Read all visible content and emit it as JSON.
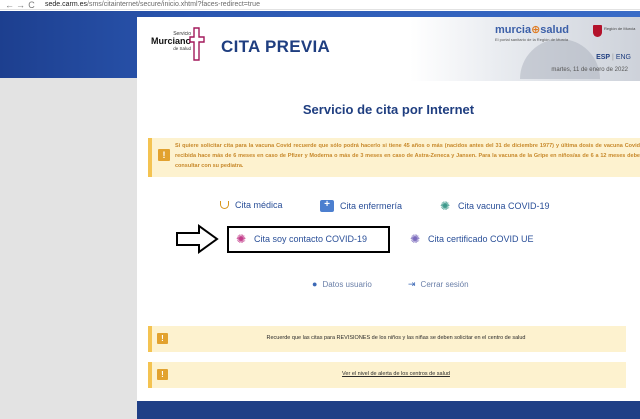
{
  "browser": {
    "nav_back": "←",
    "nav_forward": "→",
    "nav_reload": "C",
    "url_host": "sede.carm.es",
    "url_path": "/sms/citainternet/secure/inicio.xhtml?faces-redirect=true"
  },
  "header": {
    "logo": {
      "line1": "Servicio",
      "line2": "Murciano",
      "line3": "de Salud"
    },
    "title": "CITA PREVIA",
    "brand_part1": "murcia",
    "brand_dot": "⊕",
    "brand_part2": "salud",
    "brand_subtitle": "El portal sanitario de la Región de Murcia",
    "region_text": "Región de Murcia",
    "lang_esp": "ESP",
    "lang_sep": "|",
    "lang_eng": "ENG",
    "date": "martes, 11 de enero de 2022"
  },
  "main": {
    "service_title": "Servicio de cita por Internet",
    "warning": {
      "icon": "!",
      "text": "Si quiere solicitar cita para la vacuna Covid recuerde que sólo podrá hacerlo si tiene 45 años o más (nacidos antes del 31 de diciembre 1977) y última dosis de vacuna Covid recibida hace más de 6 meses en caso de Pfizer y Moderna o más de 3 meses en caso de Astra-Zeneca y Jansen. Para la vacuna de la Gripe en niños/as de 6 a 12 meses debe consultar con su pediatra."
    },
    "menu": {
      "cita_medica": "Cita médica",
      "cita_enfermeria": "Cita enfermería",
      "cita_vacuna": "Cita vacuna COVID-19",
      "cita_contacto": "Cita soy contacto COVID-19",
      "cita_certificado": "Cita certificado COVID UE"
    },
    "datos_usuario": "Datos usuario",
    "cerrar_sesion": "Cerrar sesión",
    "notice1": "Recuerde que las citas para REVISIONES de los niños y las niñas se deben solicitar en el centro de salud",
    "notice2": "Ver el nivel de alerta de los centros de salud"
  },
  "colors": {
    "primary_blue": "#1f3e80",
    "warning_bg": "#fdf2cf",
    "warning_text": "#c7882a",
    "accent_orange": "#e07a1f"
  },
  "icons": [
    "stethoscope-icon",
    "first-aid-icon",
    "virus-icon",
    "user-icon",
    "logout-icon",
    "warning-icon",
    "arrow-right-icon"
  ]
}
